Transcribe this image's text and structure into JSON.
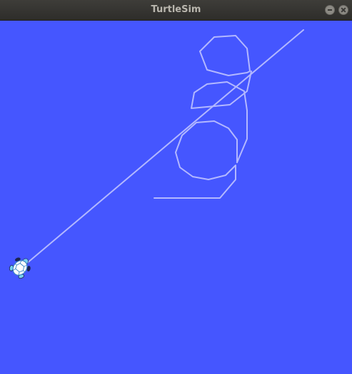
{
  "window": {
    "title": "TurtleSim",
    "background_color": "#4556ff",
    "pen_color": "#b3b8ff",
    "buttons": [
      {
        "name": "minimize",
        "icon": "minimize-icon"
      },
      {
        "name": "close",
        "icon": "close-icon"
      }
    ]
  }
}
